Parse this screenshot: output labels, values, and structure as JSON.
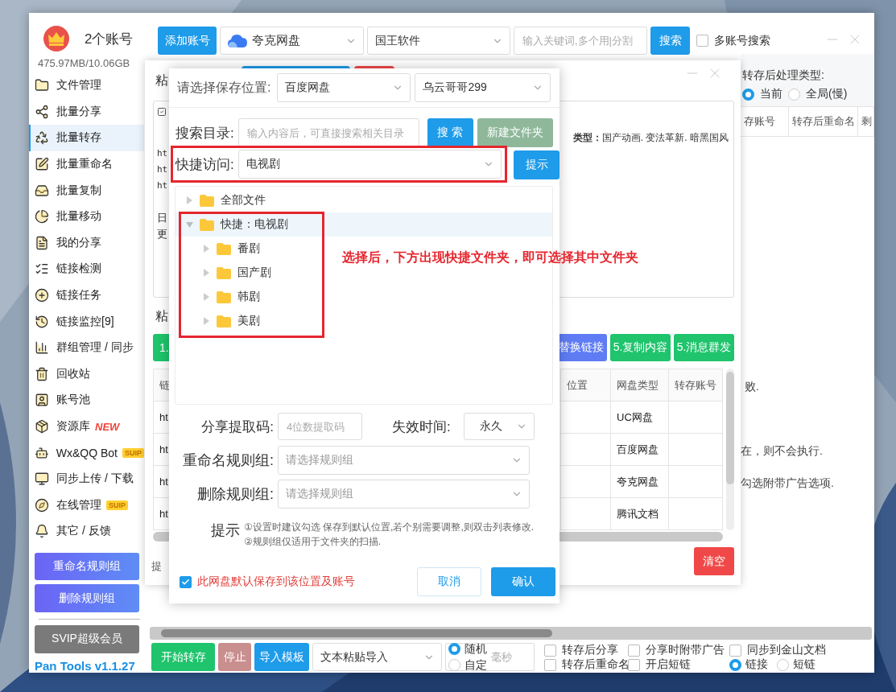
{
  "sidebar": {
    "account_count": "2个账号",
    "storage": "475.97MB/10.06GB",
    "items": [
      {
        "label": "文件管理",
        "selected": false
      },
      {
        "label": "批量分享",
        "selected": false
      },
      {
        "label": "批量转存",
        "selected": true
      },
      {
        "label": "批量重命名",
        "selected": false
      },
      {
        "label": "批量复制",
        "selected": false
      },
      {
        "label": "批量移动",
        "selected": false
      },
      {
        "label": "我的分享",
        "selected": false
      },
      {
        "label": "链接检测",
        "selected": false
      },
      {
        "label": "链接任务",
        "selected": false
      },
      {
        "label": "链接监控[9]",
        "selected": false
      },
      {
        "label": "群组管理 / 同步",
        "selected": false
      },
      {
        "label": "回收站",
        "selected": false
      },
      {
        "label": "账号池",
        "selected": false
      },
      {
        "label": "资源库",
        "selected": false,
        "badge": {
          "kind": "new",
          "text": "NEW"
        }
      },
      {
        "label": "Wx&QQ Bot",
        "selected": false,
        "badge": {
          "kind": "vip",
          "text": "SUIP"
        }
      },
      {
        "label": "同步上传 / 下载",
        "selected": false
      },
      {
        "label": "在线管理",
        "selected": false,
        "badge": {
          "kind": "vip",
          "text": "SUIP"
        }
      },
      {
        "label": "其它 / 反馈",
        "selected": false
      }
    ],
    "rule_buttons": [
      "重命名规则组",
      "删除规则组"
    ],
    "vip_button": "SVIP超级会员",
    "version": "Pan Tools v1.1.27"
  },
  "toolbar": {
    "add_account": "添加账号",
    "cloud_select": "夸克网盘",
    "folder_select": "国王软件",
    "search_placeholder": "输入关键词,多个用|分割",
    "search_button": "搜索",
    "multi_account": {
      "label": "多账号搜索",
      "checked": false
    }
  },
  "right_panel": {
    "process_label": "转存后处理类型:",
    "process_options": [
      {
        "label": "当前",
        "selected": true
      },
      {
        "label": "全局(慢)",
        "selected": false
      }
    ],
    "columns": [
      "存账号",
      "转存后重命名",
      "剩"
    ],
    "notes": [
      "败.",
      "在，则不会执行.",
      "勾选附带广告选项."
    ]
  },
  "paste_window": {
    "title": "粘",
    "link_lines": [
      "ht",
      "ht",
      "ht"
    ],
    "info_lines": [
      "日",
      "更"
    ],
    "tag_line": "**类型：**国产动画. 变法革新. 暗黑国风",
    "section_title": "粘",
    "buttons": [
      {
        "label": "1.",
        "kind": "green"
      },
      {
        "label": "替换链接",
        "kind": "blue"
      },
      {
        "label": "5.复制内容",
        "kind": "green"
      },
      {
        "label": "5.消息群发",
        "kind": "green"
      }
    ],
    "columns": [
      "链",
      "位置",
      "网盘类型",
      "转存账号"
    ],
    "rows": [
      {
        "link": "ht",
        "disk": "UC网盘"
      },
      {
        "link": "ht",
        "disk": "百度网盘"
      },
      {
        "link": "ht",
        "disk": "夸克网盘"
      },
      {
        "link": "ht",
        "disk": "腾讯文档"
      }
    ],
    "hint": "提",
    "clear_button": "清空"
  },
  "dialog": {
    "save_label": "请选择保存位置:",
    "disk_select": "百度网盘",
    "account_select": "乌云哥哥299",
    "search_label": "搜索目录:",
    "search_placeholder": "输入内容后，可直接搜索相关目录",
    "search_button": "搜 索",
    "new_folder_button": {
      "label": "新建文件夹",
      "disabled": true
    },
    "quick_label": "快捷访问:",
    "quick_select": "电视剧",
    "tip_button": "提示",
    "tree": [
      {
        "label": "全部文件",
        "expanded": false,
        "selected": false
      },
      {
        "label": "快捷：电视剧",
        "expanded": true,
        "selected": true,
        "children": [
          {
            "label": "番剧",
            "expanded": false,
            "selected": false
          },
          {
            "label": "国产剧",
            "expanded": false,
            "selected": false
          },
          {
            "label": "韩剧",
            "expanded": false,
            "selected": false
          },
          {
            "label": "美剧",
            "expanded": false,
            "selected": false
          }
        ]
      }
    ],
    "annotation": "选择后，下方出现快捷文件夹，即可选择其中文件夹",
    "code_label": "分享提取码:",
    "code_placeholder": "4位数提取码",
    "expire_label": "失效时间:",
    "expire_select": "永久",
    "rename_label": "重命名规则组:",
    "rename_placeholder": "请选择规则组",
    "delete_label": "删除规则组:",
    "delete_placeholder": "请选择规则组",
    "tip_title": "提示",
    "tips": [
      "①设置时建议勾选 保存到默认位置,若个别需要调整,则双击列表修改.",
      "②规则组仅适用于文件夹的扫描."
    ],
    "default_save": {
      "label": "此网盘默认保存到该位置及账号",
      "checked": true
    },
    "cancel_button": "取消",
    "ok_button": "确认"
  },
  "bottom_bar": {
    "start_button": "开始转存",
    "stop_button": {
      "label": "停止",
      "disabled": true
    },
    "import_button": "导入模板",
    "import_select": "文本粘贴导入",
    "interval": [
      {
        "label": "随机",
        "selected": true
      },
      {
        "label": "自定",
        "selected": false
      }
    ],
    "ms_placeholder": "毫秒",
    "options": [
      {
        "label": "转存后分享",
        "checked": false
      },
      {
        "label": "转存后重命名",
        "checked": false
      },
      {
        "label": "分享时附带广告",
        "checked": false
      },
      {
        "label": "开启短链",
        "checked": false
      },
      {
        "label": "同步到金山文档",
        "checked": false
      }
    ],
    "link_type": [
      {
        "label": "链接",
        "selected": true
      },
      {
        "label": "短链",
        "selected": false
      }
    ]
  }
}
